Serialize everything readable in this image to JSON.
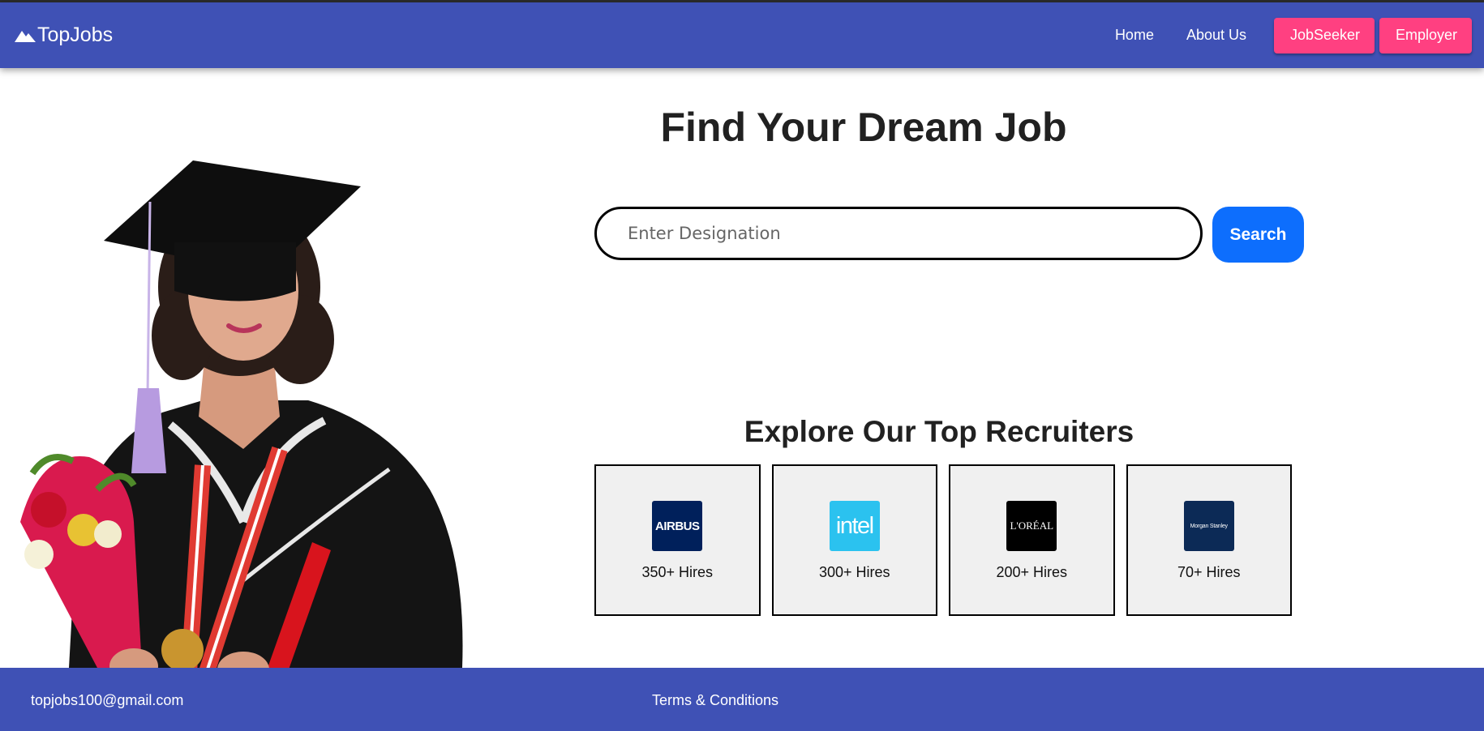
{
  "navbar": {
    "brand": "TopJobs",
    "brand_icon": "mountain-icon",
    "links": {
      "home": "Home",
      "about": "About Us"
    },
    "buttons": {
      "jobseeker": "JobSeeker",
      "employer": "Employer"
    }
  },
  "hero": {
    "title": "Find Your Dream Job",
    "search_placeholder": "Enter Designation",
    "search_button": "Search"
  },
  "recruiters": {
    "title": "Explore Our Top Recruiters",
    "items": [
      {
        "logo_text": "AIRBUS",
        "hires": "350+ Hires"
      },
      {
        "logo_text": "intel",
        "hires": "300+ Hires"
      },
      {
        "logo_text": "L'ORÉAL",
        "hires": "200+ Hires"
      },
      {
        "logo_text": "Morgan Stanley",
        "hires": "70+ Hires"
      }
    ]
  },
  "footer": {
    "email": "topjobs100@gmail.com",
    "terms": "Terms & Conditions"
  },
  "colors": {
    "primary": "#3f51b5",
    "accent": "#ff4081",
    "search_button": "#0d6efd",
    "card_bg": "#f0f0f0"
  }
}
